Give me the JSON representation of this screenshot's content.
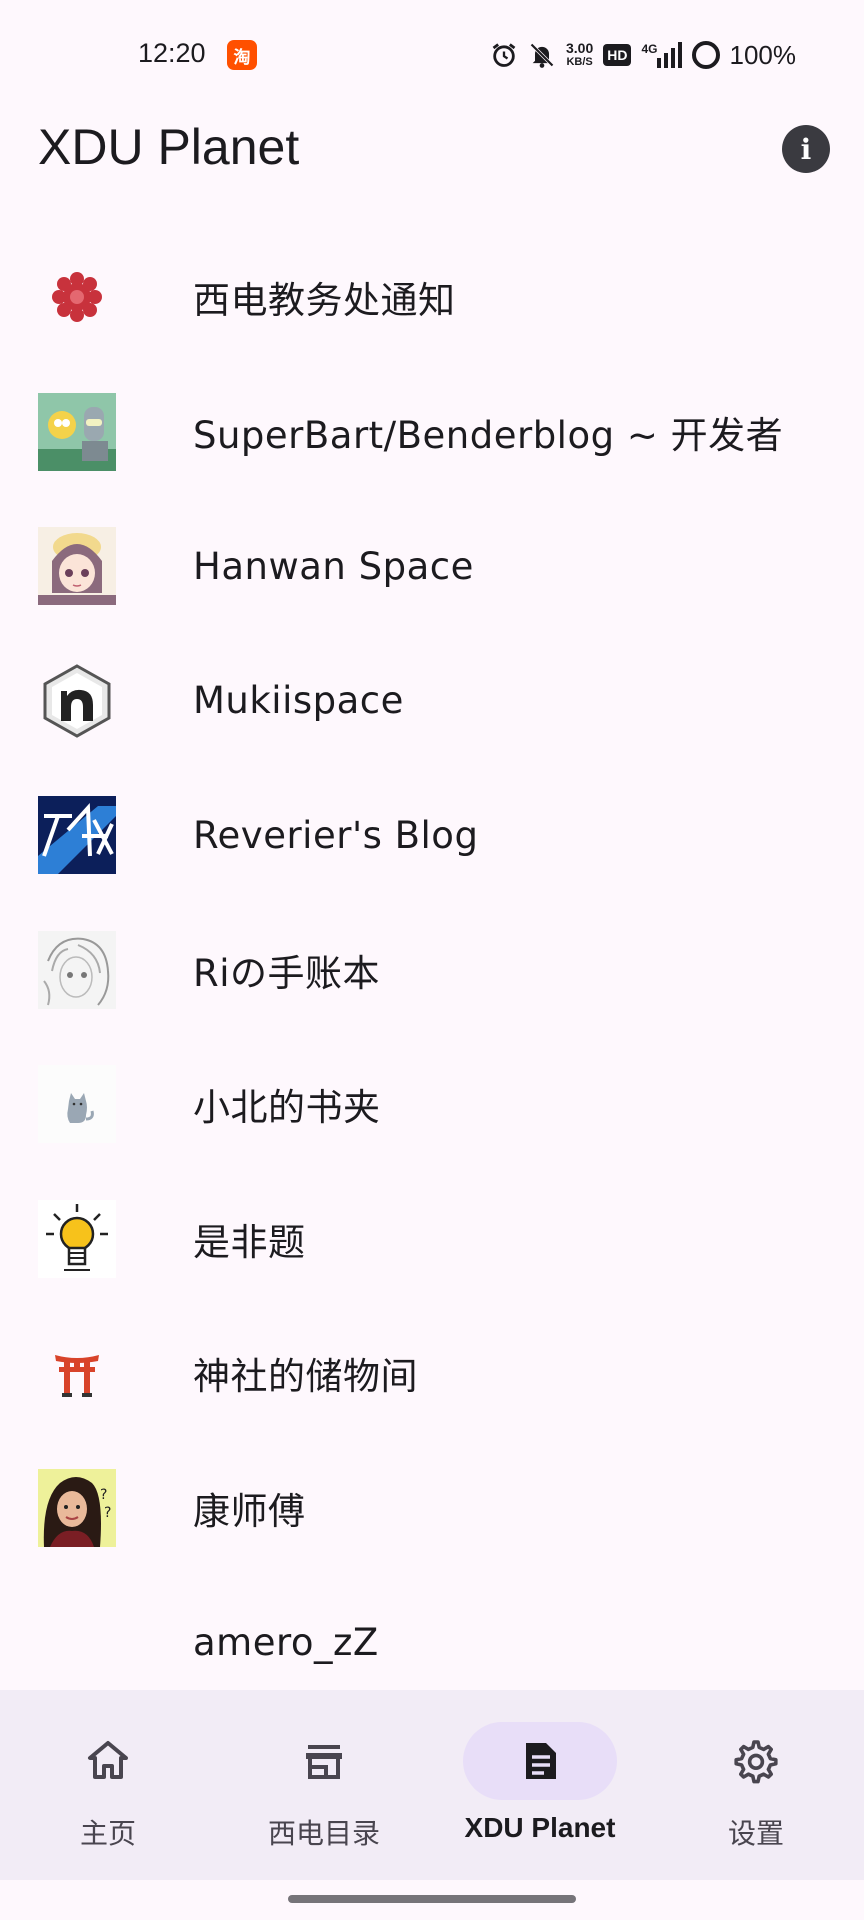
{
  "status_bar": {
    "time": "12:20",
    "app_badge": "淘",
    "net_speed_value": "3.00",
    "net_speed_unit": "KB/S",
    "hd": "HD",
    "network": "4G",
    "battery": "100%"
  },
  "app_bar": {
    "title": "XDU Planet",
    "info_icon": "i"
  },
  "feeds": [
    {
      "label": "西电教务处通知",
      "icon": "red-flower-logo"
    },
    {
      "label": "SuperBart/Benderblog ~ 开发者",
      "icon": "cartoon-avatar"
    },
    {
      "label": "Hanwan Space",
      "icon": "anime-girl-avatar"
    },
    {
      "label": "Mukiispace",
      "icon": "hexagon-n-logo"
    },
    {
      "label": "Reverier's Blog",
      "icon": "blue-signature-logo"
    },
    {
      "label": "Riの手账本",
      "icon": "sketch-avatar"
    },
    {
      "label": "小北的书夹",
      "icon": "cat-avatar"
    },
    {
      "label": "是非题",
      "icon": "lightbulb-avatar"
    },
    {
      "label": "神社的储物间",
      "icon": "torii-gate-icon"
    },
    {
      "label": "康师傅",
      "icon": "child-photo-avatar"
    },
    {
      "label": "amero_zZ",
      "icon": ""
    }
  ],
  "bottom_nav": [
    {
      "label": "主页",
      "icon": "home-icon"
    },
    {
      "label": "西电目录",
      "icon": "storefront-icon"
    },
    {
      "label": "XDU Planet",
      "icon": "article-icon"
    },
    {
      "label": "设置",
      "icon": "gear-icon"
    }
  ],
  "colors": {
    "background": "#fef8fd",
    "nav_background": "#f2ecf6",
    "active_pill": "#e8def8"
  }
}
